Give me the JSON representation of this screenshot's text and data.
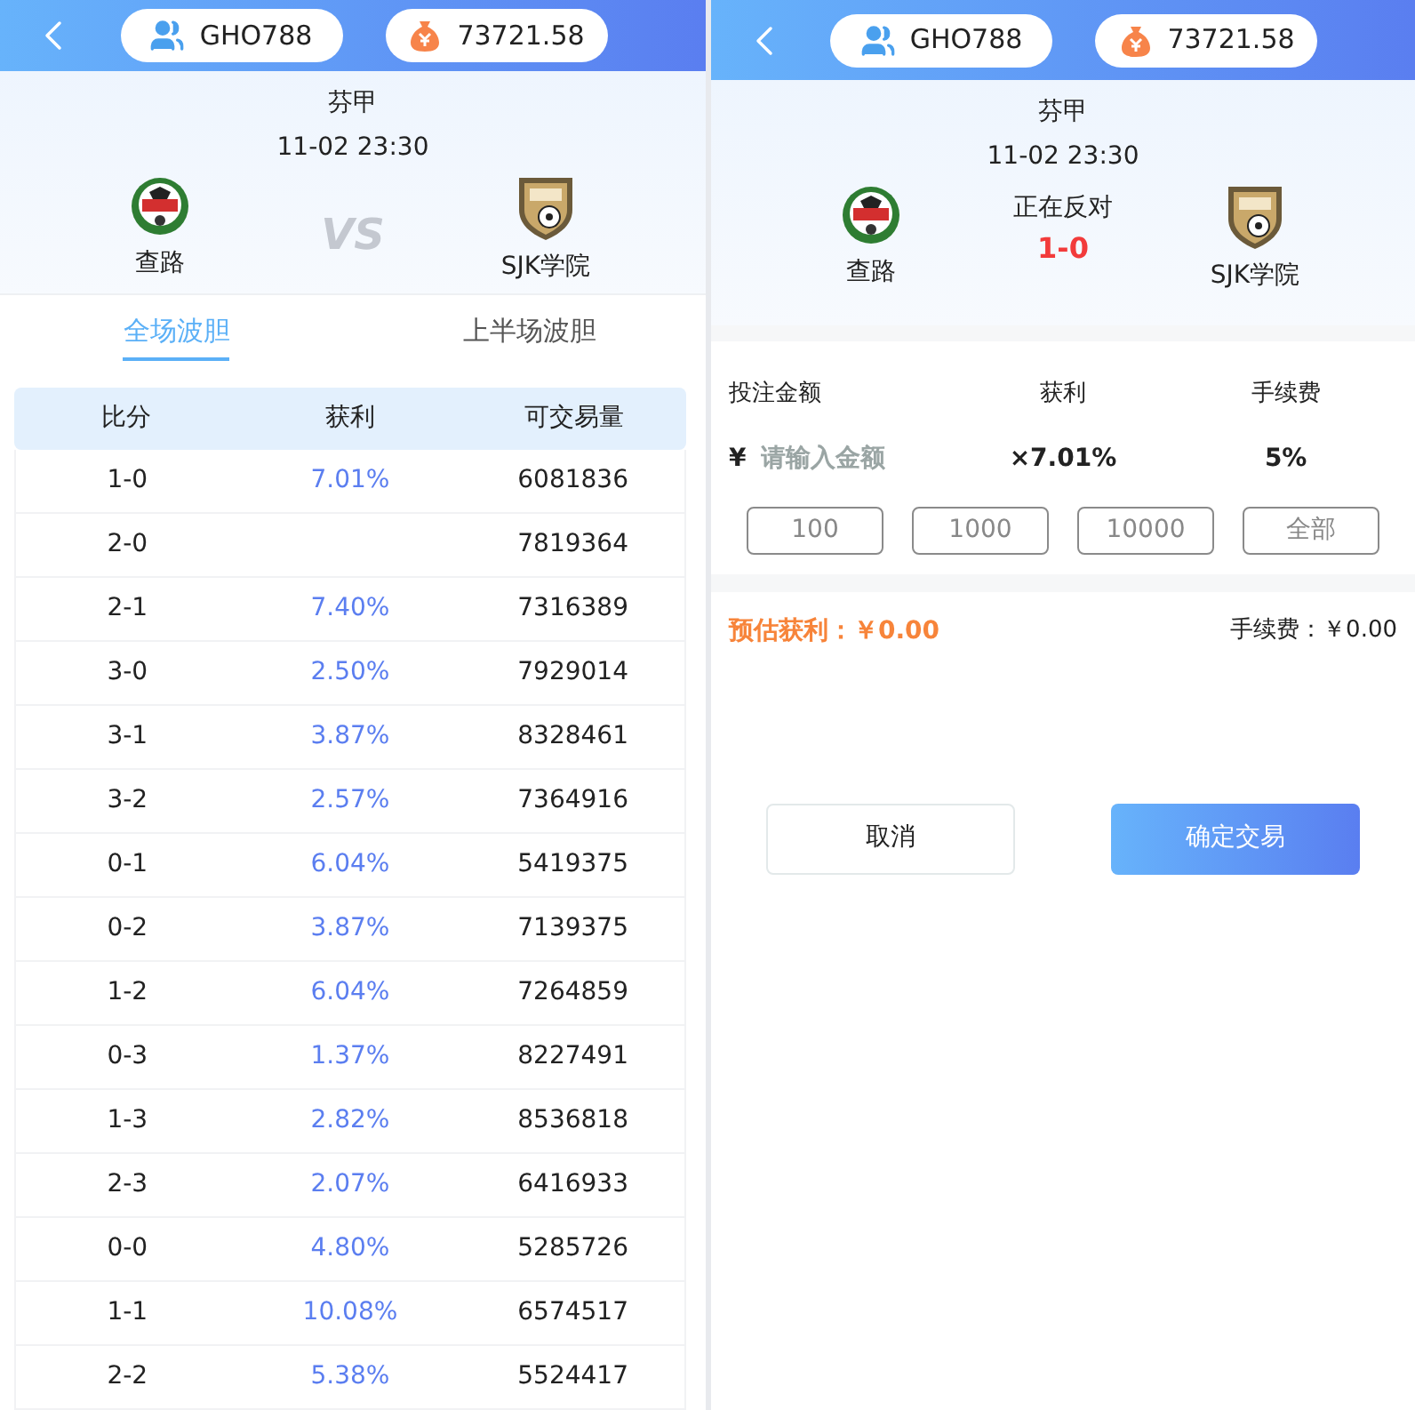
{
  "left_screen": {
    "header": {
      "username": "GHO788",
      "balance": "73721.58"
    },
    "match": {
      "league": "芬甲",
      "time": "11-02 23:30",
      "vs": "VS",
      "home": {
        "name": "查路"
      },
      "away": {
        "name": "SJK学院"
      }
    },
    "tabs": [
      {
        "label": "全场波胆",
        "selected": true
      },
      {
        "label": "上半场波胆",
        "selected": false
      }
    ],
    "table": {
      "columns": [
        "比分",
        "获利",
        "可交易量"
      ],
      "rows": [
        {
          "score": "1-0",
          "profit": "7.01%",
          "volume": "6081836"
        },
        {
          "score": "2-0",
          "volume": "7819364"
        },
        {
          "score": "2-1",
          "profit": "7.40%",
          "volume": "7316389"
        },
        {
          "score": "3-0",
          "profit": "2.50%",
          "volume": "7929014"
        },
        {
          "score": "3-1",
          "profit": "3.87%",
          "volume": "8328461"
        },
        {
          "score": "3-2",
          "profit": "2.57%",
          "volume": "7364916"
        },
        {
          "score": "0-1",
          "profit": "6.04%",
          "volume": "5419375"
        },
        {
          "score": "0-2",
          "profit": "3.87%",
          "volume": "7139375"
        },
        {
          "score": "1-2",
          "profit": "6.04%",
          "volume": "7264859"
        },
        {
          "score": "0-3",
          "profit": "1.37%",
          "volume": "8227491"
        },
        {
          "score": "1-3",
          "profit": "2.82%",
          "volume": "8536818"
        },
        {
          "score": "2-3",
          "profit": "2.07%",
          "volume": "6416933"
        },
        {
          "score": "0-0",
          "profit": "4.80%",
          "volume": "5285726"
        },
        {
          "score": "1-1",
          "profit": "10.08%",
          "volume": "6574517"
        },
        {
          "score": "2-2",
          "profit": "5.38%",
          "volume": "5524417"
        }
      ]
    }
  },
  "right_screen": {
    "header": {
      "username": "GHO788",
      "balance": "73721.58"
    },
    "match": {
      "league": "芬甲",
      "time": "11-02 23:30",
      "status": "正在反对",
      "score": "1-0",
      "home": {
        "name": "查路"
      },
      "away": {
        "name": "SJK学院"
      }
    },
    "bet_form": {
      "columns": [
        "投注金额",
        "获利",
        "手续费"
      ],
      "currency": "¥",
      "amount_placeholder": "请输入金额",
      "profit": "×7.01%",
      "fee": "5%",
      "presets": [
        "100",
        "1000",
        "10000",
        "全部"
      ],
      "estimate_label": "预估获利：",
      "estimate_value": "￥0.00",
      "fee_label": "手续费：",
      "fee_value": "￥0.00"
    },
    "buttons": {
      "cancel": "取消",
      "confirm": "确定交易"
    }
  }
}
